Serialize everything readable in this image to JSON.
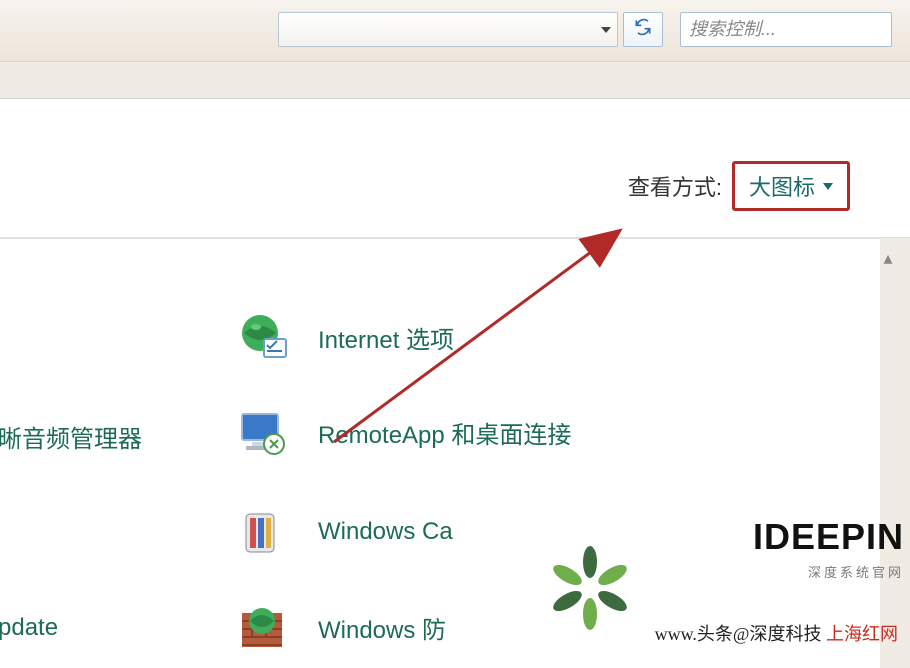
{
  "toolbar": {
    "search_placeholder": "搜索控制..."
  },
  "header": {
    "view_label": "查看方式:",
    "view_value": "大图标"
  },
  "items": {
    "internet": "Internet 选项",
    "audio_mgr_partial": "晰音频管理器",
    "remoteapp": "RemoteApp 和桌面连接",
    "windows_ca": "Windows Ca",
    "update_partial": "pdate",
    "windows_def": "Windows 防"
  },
  "watermark": {
    "brand": "IDEEPIN",
    "sub": "深度系统官网",
    "url_prefix": "www.",
    "url_mid": "头条@深度科技",
    "red": "上海红网"
  }
}
